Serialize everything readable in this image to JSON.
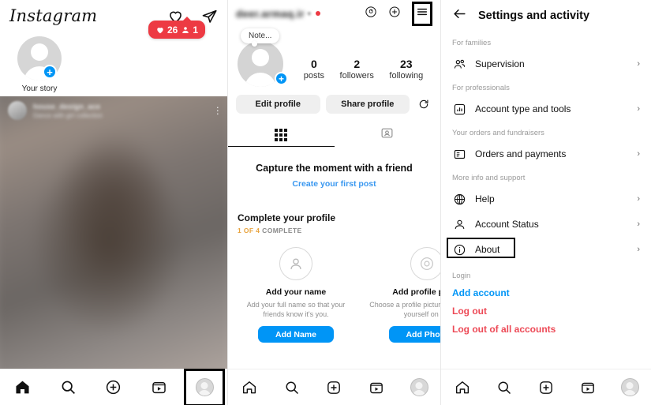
{
  "feed": {
    "logo": "Instagram",
    "heart_icon": "heart-icon",
    "share_icon": "paper-plane-icon",
    "notification": {
      "likes": "26",
      "followers": "1",
      "heart_icon": "heart-filled-icon",
      "person_icon": "person-filled-icon",
      "color": "#ED3A43"
    },
    "story": {
      "label": "Your story",
      "add_icon": "plus-badge-icon"
    },
    "post": {
      "username": "house_design_ace",
      "subtitle": "Dance with girl collection",
      "more_icon": "more-options-icon"
    }
  },
  "profile": {
    "username": "deer.armaq.ir",
    "chevron": "▾",
    "threads_icon": "threads-icon",
    "add_icon": "plus-square-icon",
    "menu_icon": "hamburger-menu-icon",
    "note": "Note...",
    "avatar_add_icon": "plus-badge-icon",
    "stats": [
      {
        "value": "0",
        "label": "posts"
      },
      {
        "value": "2",
        "label": "followers"
      },
      {
        "value": "23",
        "label": "following"
      }
    ],
    "edit_profile": "Edit profile",
    "share_profile": "Share profile",
    "refresh_icon": "refresh-icon",
    "tabs": [
      {
        "name": "grid-tab",
        "icon": "grid-icon",
        "active": true
      },
      {
        "name": "tagged-tab",
        "icon": "tagged-icon",
        "active": false
      }
    ],
    "capture_title": "Capture the moment with a friend",
    "create_first_post": "Create your first post",
    "complete_title": "Complete your profile",
    "progress_done": "1 OF 4",
    "progress_rest": " COMPLETE",
    "cards": [
      {
        "icon": "person-outline-icon",
        "title": "Add your name",
        "desc": "Add your full name so that your friends know it's you.",
        "button": "Add Name"
      },
      {
        "icon": "camera-outline-icon",
        "title": "Add profile photo",
        "desc": "Choose a profile picture to represent yourself on Ins",
        "button": "Add Photo"
      }
    ]
  },
  "settings": {
    "back_icon": "back-arrow-icon",
    "title": "Settings and activity",
    "groups": [
      {
        "section": "For families",
        "rows": [
          {
            "icon": "supervision-icon",
            "label": "Supervision",
            "chevron": "›",
            "highlight": false
          }
        ]
      },
      {
        "section": "For professionals",
        "rows": [
          {
            "icon": "chart-square-icon",
            "label": "Account type and tools",
            "chevron": "›",
            "highlight": false
          }
        ]
      },
      {
        "section": "Your orders and fundraisers",
        "rows": [
          {
            "icon": "orders-icon",
            "label": "Orders and payments",
            "chevron": "›",
            "highlight": false
          }
        ]
      },
      {
        "section": "More info and support",
        "rows": [
          {
            "icon": "help-icon",
            "label": "Help",
            "chevron": "›",
            "highlight": false
          },
          {
            "icon": "account-status-icon",
            "label": "Account Status",
            "chevron": "›",
            "highlight": false
          },
          {
            "icon": "info-circle-icon",
            "label": "About",
            "chevron": "›",
            "highlight": true
          }
        ]
      }
    ],
    "login_label": "Login",
    "add_account": "Add account",
    "log_out": "Log out",
    "log_out_all": "Log out of all accounts",
    "colors": {
      "blue": "#0095F6",
      "red": "#ED4956"
    }
  },
  "bottom_nav": {
    "items": [
      {
        "name": "home",
        "icon": "home-icon"
      },
      {
        "name": "search",
        "icon": "search-icon"
      },
      {
        "name": "create",
        "icon": "plus-square-icon"
      },
      {
        "name": "reels",
        "icon": "reels-icon"
      },
      {
        "name": "profile",
        "icon": "profile-avatar-icon"
      }
    ]
  }
}
